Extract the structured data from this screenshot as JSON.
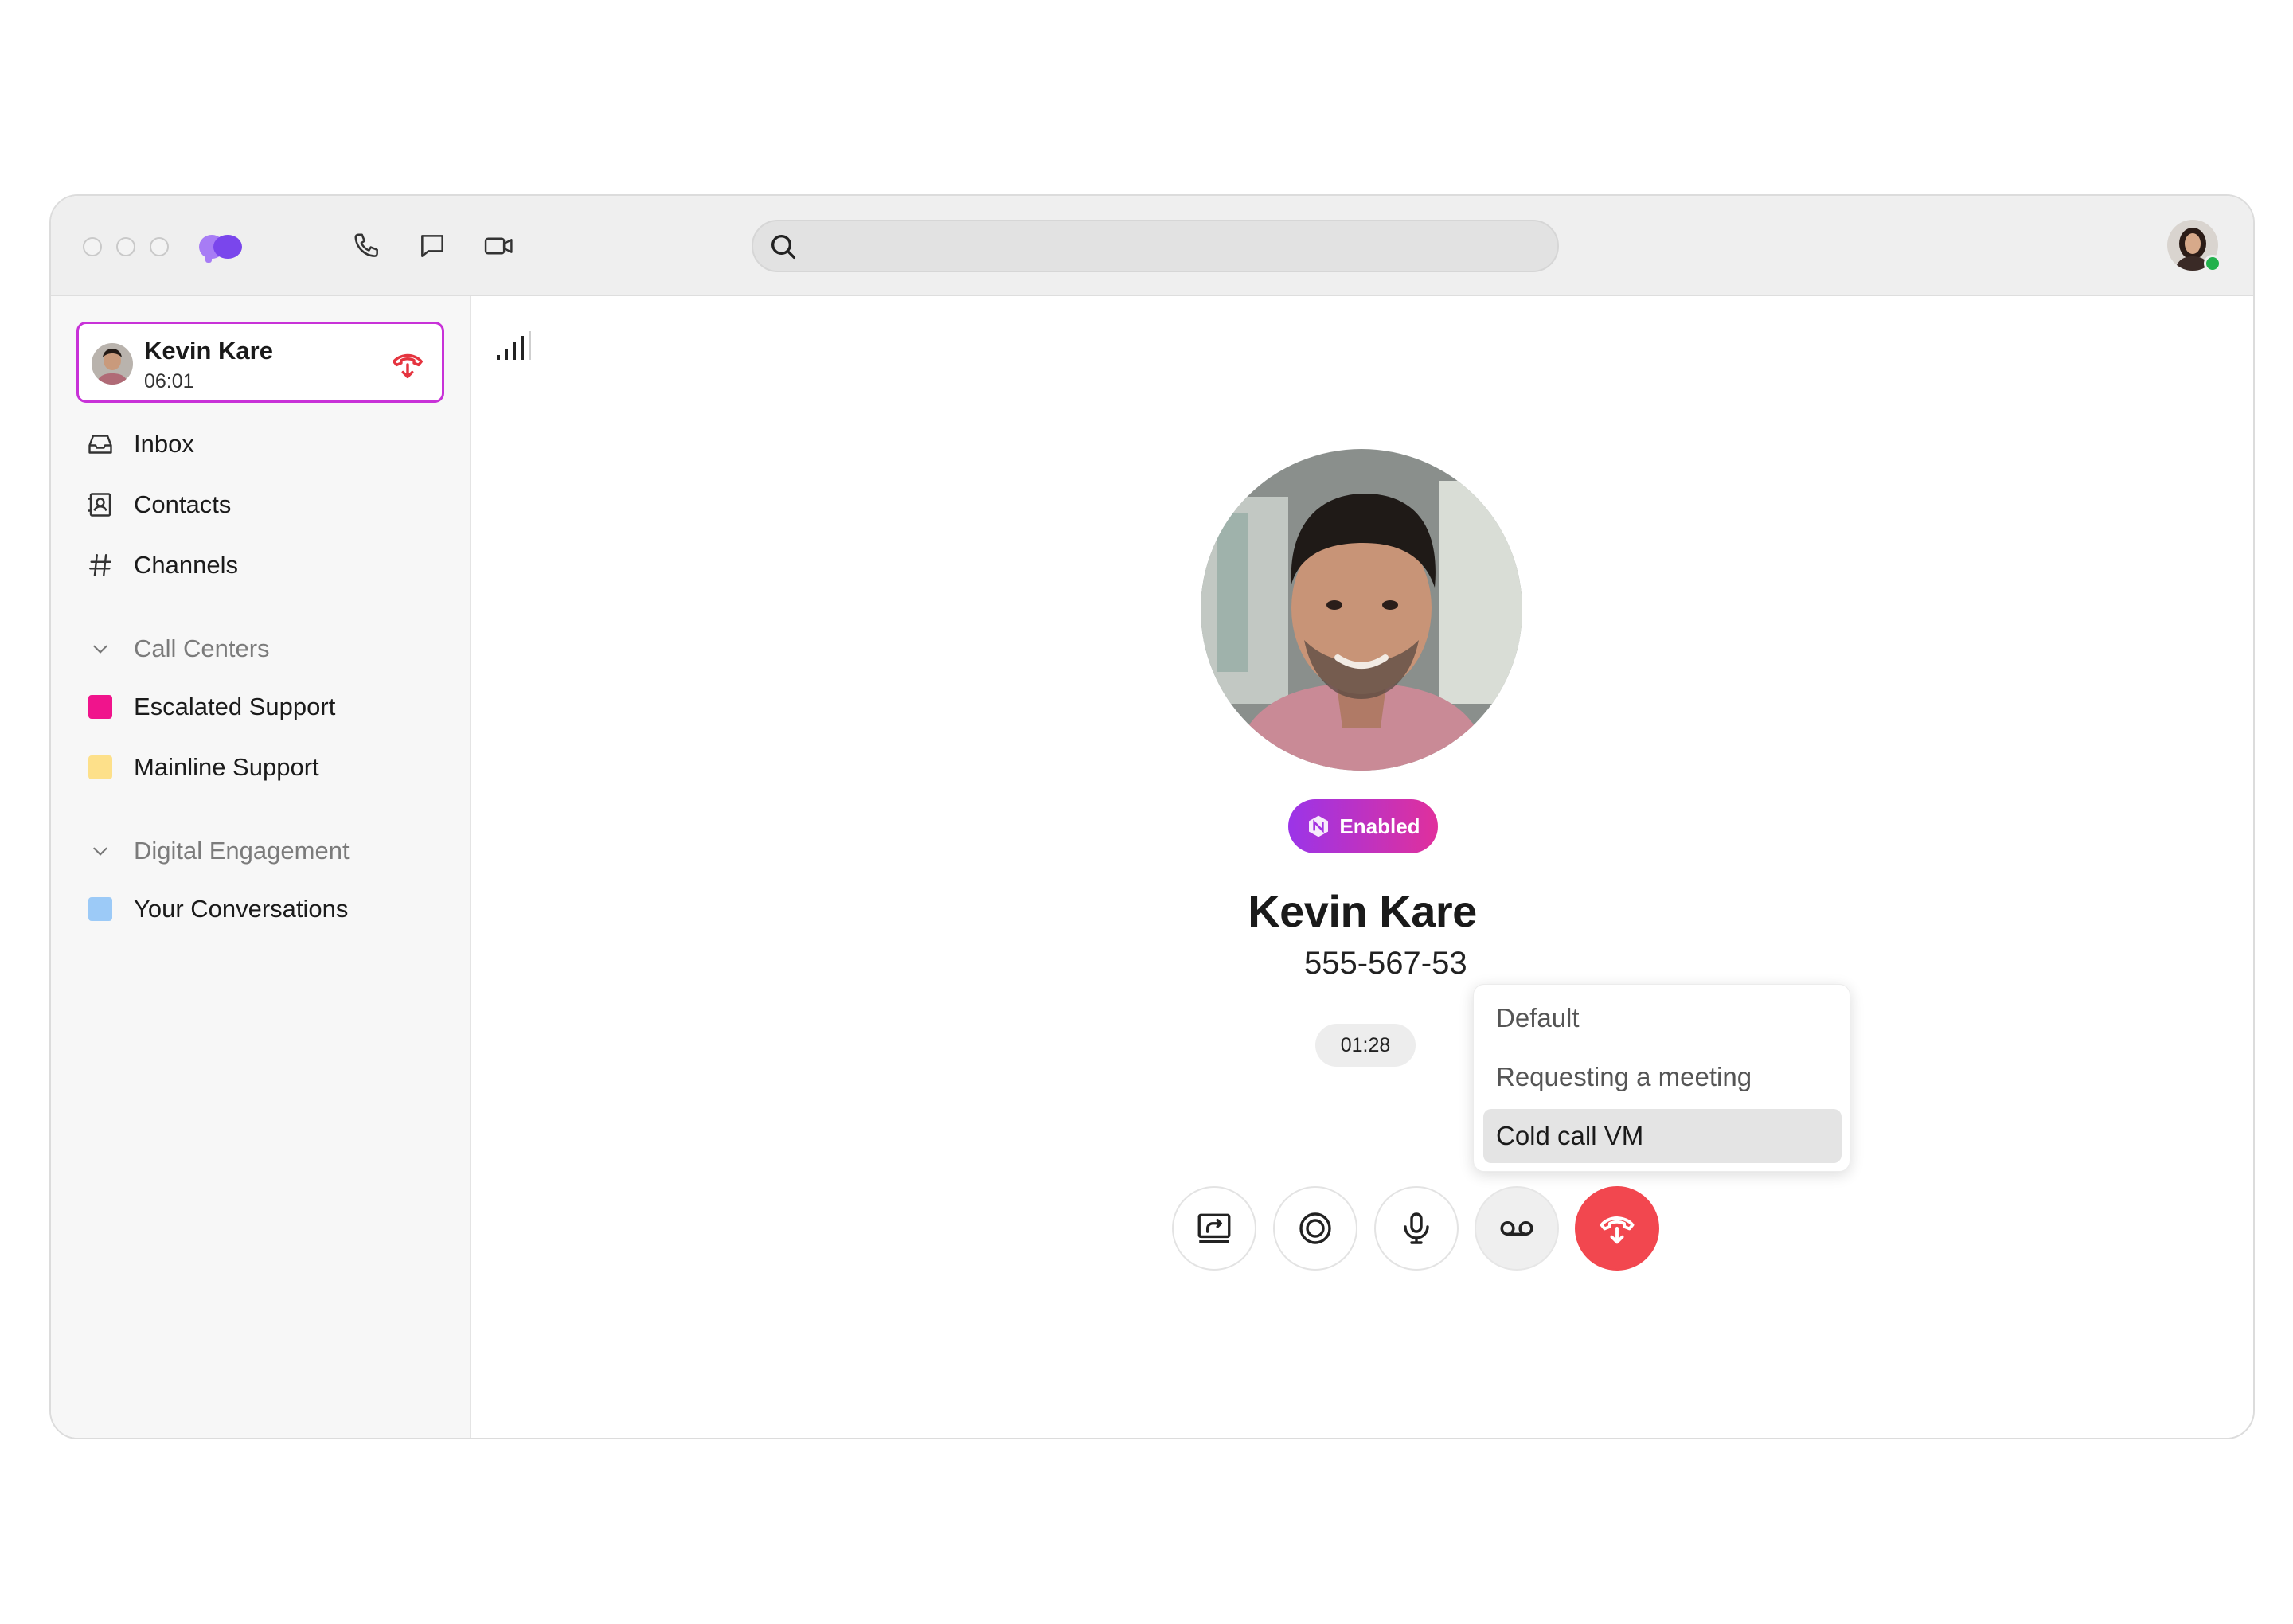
{
  "titlebar": {
    "nav_icons": [
      "phone-icon",
      "chat-icon",
      "video-icon"
    ],
    "search": {
      "placeholder": "",
      "value": ""
    }
  },
  "sidebar": {
    "active_call": {
      "name": "Kevin Kare",
      "duration": "06:01"
    },
    "items": [
      {
        "label": "Inbox",
        "icon": "inbox-icon"
      },
      {
        "label": "Contacts",
        "icon": "contacts-icon"
      },
      {
        "label": "Channels",
        "icon": "hash-icon"
      }
    ],
    "sections": [
      {
        "label": "Call Centers",
        "items": [
          {
            "label": "Escalated Support",
            "color": "#f0148c"
          },
          {
            "label": "Mainline Support",
            "color": "#fde08a"
          }
        ]
      },
      {
        "label": "Digital Engagement",
        "items": [
          {
            "label": "Your Conversations",
            "color": "#9ccaf7"
          }
        ]
      }
    ]
  },
  "call": {
    "badge": "Enabled",
    "name": "Kevin Kare",
    "phone": "555-567-53",
    "timer": "01:28",
    "controls": [
      "screen-share-icon",
      "record-icon",
      "microphone-icon",
      "voicemail-icon",
      "hang-up-icon"
    ]
  },
  "voicemail_menu": {
    "options": [
      "Default",
      "Requesting a meeting",
      "Cold call VM"
    ],
    "selected": "Cold call VM"
  },
  "colors": {
    "accent": "#c832d8",
    "end_call": "#f2474f",
    "online": "#22b14c",
    "logo": "#8a4cf0"
  }
}
